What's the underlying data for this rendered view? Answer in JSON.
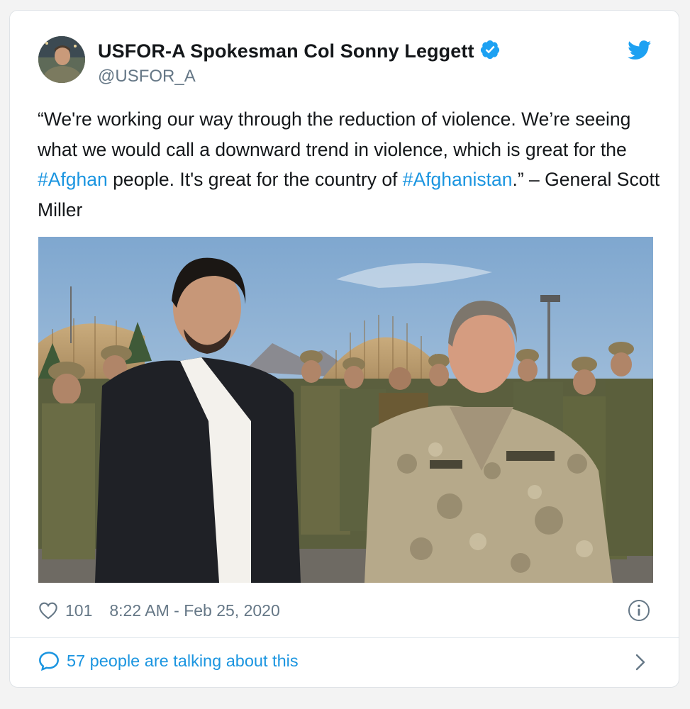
{
  "tweet": {
    "author": {
      "display_name": "USFOR-A Spokesman Col Sonny Leggett",
      "handle": "@USFOR_A",
      "verified": true
    },
    "text_segments": [
      {
        "text": "“We're working our way through the reduction of violence. We’re seeing what we would call a downward trend in violence, which is great for the ",
        "type": "text"
      },
      {
        "text": "#Afghan",
        "type": "hashtag"
      },
      {
        "text": " people. It's great for the country of ",
        "type": "text"
      },
      {
        "text": "#Afghanistan",
        "type": "hashtag"
      },
      {
        "text": ".” – General Scott Miller",
        "type": "text"
      }
    ],
    "likes": "101",
    "timestamp": "8:22 AM - Feb 25, 2020",
    "talking": "57 people are talking about this"
  },
  "icons": {
    "avatar": "avatar",
    "verified": "verified-badge-icon",
    "brand": "twitter-bird-icon",
    "like": "heart-icon",
    "info": "info-icon",
    "comment": "speech-bubble-icon",
    "more": "chevron-right-icon"
  },
  "colors": {
    "link": "#1b95e0",
    "text": "#14171a",
    "secondary": "#657786",
    "border": "#e1e8ed"
  }
}
